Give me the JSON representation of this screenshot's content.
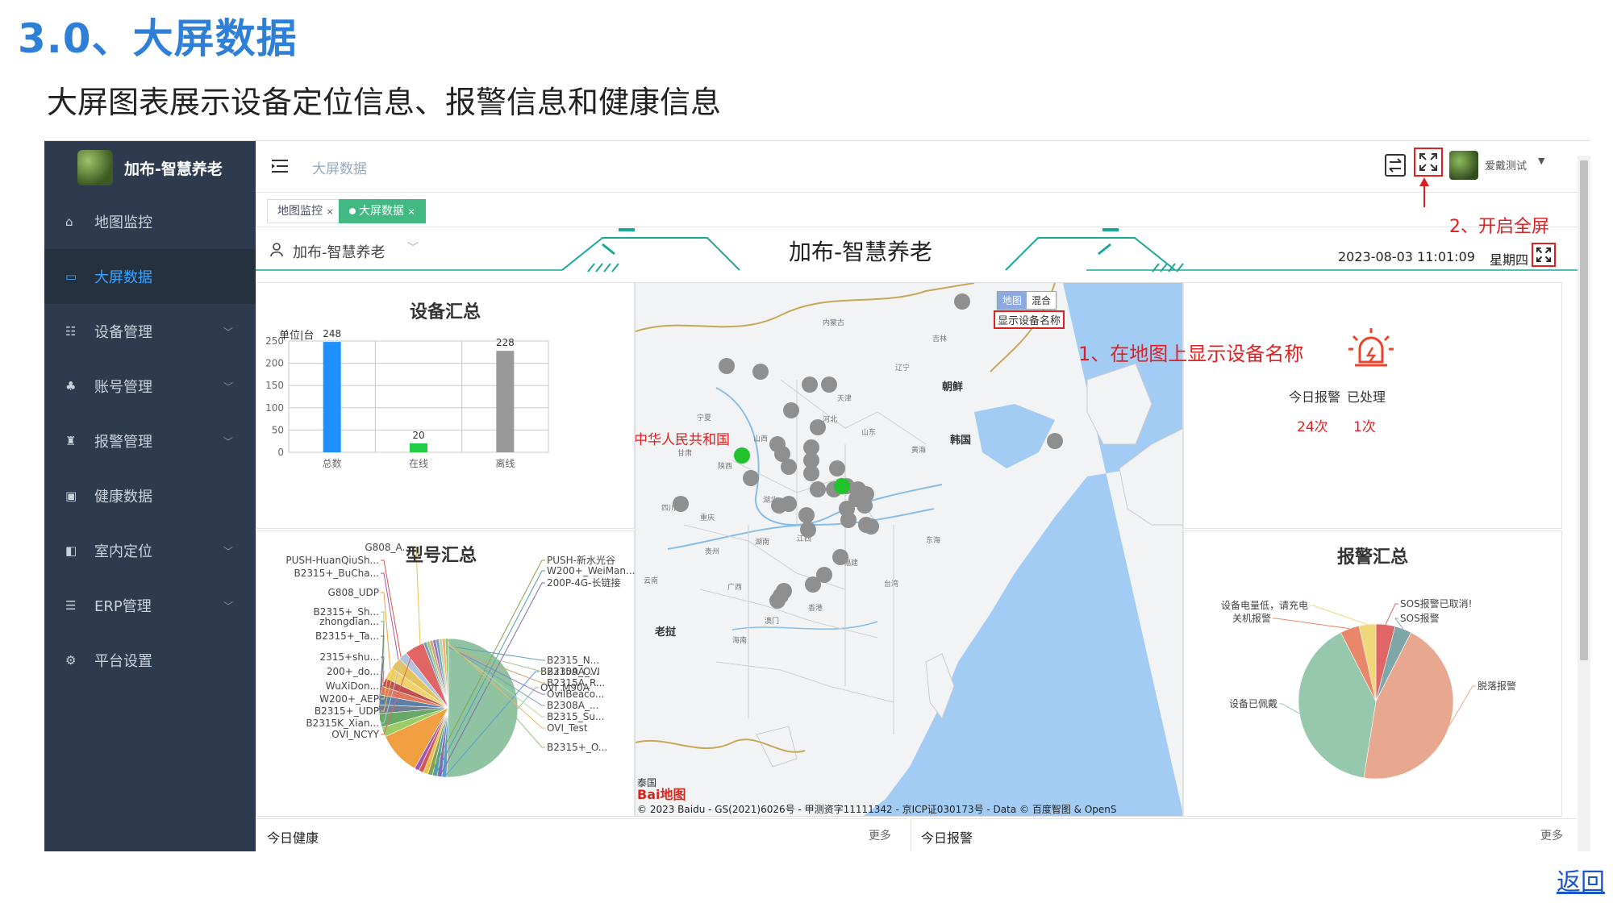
{
  "doc": {
    "heading": "3.0、大屏数据",
    "subheading": "大屏图表展示设备定位信息、报警信息和健康信息",
    "back_link": "返回"
  },
  "sidebar": {
    "brand": "加布-智慧养老",
    "items": [
      {
        "label": "地图监控",
        "icon": "home-icon",
        "active": false,
        "expandable": false
      },
      {
        "label": "大屏数据",
        "icon": "chart-icon",
        "active": true,
        "expandable": false
      },
      {
        "label": "设备管理",
        "icon": "device-icon",
        "active": false,
        "expandable": true
      },
      {
        "label": "账号管理",
        "icon": "org-icon",
        "active": false,
        "expandable": true
      },
      {
        "label": "报警管理",
        "icon": "alarm-icon",
        "active": false,
        "expandable": true
      },
      {
        "label": "健康数据",
        "icon": "health-icon",
        "active": false,
        "expandable": false
      },
      {
        "label": "室内定位",
        "icon": "location-icon",
        "active": false,
        "expandable": true
      },
      {
        "label": "ERP管理",
        "icon": "list-icon",
        "active": false,
        "expandable": true
      },
      {
        "label": "平台设置",
        "icon": "gear-icon",
        "active": false,
        "expandable": false
      }
    ]
  },
  "header": {
    "breadcrumb": "大屏数据",
    "username": "爱戴测试",
    "tabs": [
      "地图监控",
      "大屏数据"
    ]
  },
  "dashboard": {
    "org_select": "加布-智慧养老",
    "title": "加布-智慧养老",
    "datetime": "2023-08-03 11:01:09",
    "weekday": "星期四"
  },
  "annotations": {
    "fullscreen": "2、开启全屏",
    "show_names": "1、在地图上显示设备名称"
  },
  "device_summary": {
    "title": "设备汇总",
    "unit": "单位|台"
  },
  "model_summary": {
    "title": "型号汇总"
  },
  "map": {
    "btn_map": "地图",
    "btn_mixed": "混合",
    "show_names_btn": "显示设备名称",
    "country_label": "中华人民共和国",
    "copyright": "© 2023 Baidu - GS(2021)6026号 - 甲测资字11111342 - 京ICP证030173号 - Data © 百度智图 & OpenS",
    "labels": {
      "neimenggu": "内蒙古",
      "jilin": "吉林",
      "liaoning": "辽宁",
      "chaoxian": "朝鲜",
      "hanguo": "韩国",
      "tianjin": "天津",
      "hebei": "河北",
      "shanxi": "山西",
      "shandong": "山东",
      "ningxia": "宁夏",
      "gansu": "甘肃",
      "shaanxi": "陕西",
      "huanghai": "黄海",
      "sichuan": "四川",
      "hubei": "湖北",
      "chongqing": "重庆",
      "donghai": "东海",
      "guizhou": "贵州",
      "hunan": "湖南",
      "jiangxi": "江西",
      "fujian": "福建",
      "yunnan": "云南",
      "guangxi": "广西",
      "taiwan": "台湾",
      "laowo": "老挝",
      "hainan": "海南",
      "aomen": "澳门",
      "xianggang": "香港",
      "taiguo": "泰国"
    },
    "baidu_logo": "Bai地图"
  },
  "alarm_today": {
    "today_label": "今日报警",
    "handled_label": "已处理",
    "today_count": "24次",
    "handled_count": "1次"
  },
  "alarm_summary": {
    "title": "报警汇总"
  },
  "bottom": {
    "health_title": "今日健康",
    "alarm_title": "今日报警",
    "more": "更多"
  },
  "colors": {
    "sidebar_bg": "#2e3b4e",
    "active_blue": "#3aa3ff",
    "tab_green": "#42b983",
    "annotation_red": "#e02020",
    "teal": "#1aa79a"
  },
  "chart_data": [
    {
      "type": "bar",
      "title": "设备汇总",
      "ylabel": "单位|台",
      "categories": [
        "总数",
        "在线",
        "离线"
      ],
      "values": [
        248,
        20,
        228
      ],
      "colors": [
        "#1e90ff",
        "#22cc44",
        "#999999"
      ],
      "ylim": [
        0,
        250
      ],
      "yticks": [
        0,
        50,
        100,
        150,
        200,
        250
      ],
      "grid": true
    },
    {
      "type": "pie",
      "title": "型号汇总",
      "slices": [
        {
          "label": "OVI_M90A",
          "value": 55,
          "color": "#8fc3a2"
        },
        {
          "label": "B2315A_OVI",
          "value": 1.2,
          "color": "#5a9bd4"
        },
        {
          "label": "200P-4G-长链接",
          "value": 1.2,
          "color": "#7f6bb5"
        },
        {
          "label": "W200+_WeiMan...",
          "value": 1.2,
          "color": "#4aa0a8"
        },
        {
          "label": "PUSH-新水光谷",
          "value": 1.2,
          "color": "#8aa04c"
        },
        {
          "label": "G808_A...",
          "value": 1.2,
          "color": "#e8c04a"
        },
        {
          "label": "PUSH-HuanQiuSh...",
          "value": 1.2,
          "color": "#d9534f"
        },
        {
          "label": "B2315+_BuCha...",
          "value": 1.2,
          "color": "#9b59b6"
        },
        {
          "label": "G808_UDP",
          "value": 11,
          "color": "#f0a040"
        },
        {
          "label": "B2315+_Sh...",
          "value": 2.5,
          "color": "#9ccc65"
        },
        {
          "label": "zhongdian...",
          "value": 3.5,
          "color": "#66aa66"
        },
        {
          "label": "B2315+_Ta...",
          "value": 2.2,
          "color": "#708090"
        },
        {
          "label": "2315+shu...",
          "value": 2.5,
          "color": "#5b7fa6"
        },
        {
          "label": "200+_do...",
          "value": 2.2,
          "color": "#e07860"
        },
        {
          "label": "WuXiDon...",
          "value": 2.2,
          "color": "#c0504d"
        },
        {
          "label": "W200+_AEP",
          "value": 3,
          "color": "#f2d36b"
        },
        {
          "label": "B2315+_UDP",
          "value": 3,
          "color": "#e6c25a"
        },
        {
          "label": "B2315K_Xian...",
          "value": 2.2,
          "color": "#b0c4de"
        },
        {
          "label": "OVI_NCYY",
          "value": 5,
          "color": "#e06666"
        },
        {
          "label": "B2315_N...",
          "value": 0.8,
          "color": "#6a9fb5"
        },
        {
          "label": "B2309A_...",
          "value": 0.8,
          "color": "#a3c586"
        },
        {
          "label": "B2315A_R...",
          "value": 0.8,
          "color": "#d4a373"
        },
        {
          "label": "OvilBeaco...",
          "value": 0.8,
          "color": "#8e7cc3"
        },
        {
          "label": "B2308A_...",
          "value": 0.8,
          "color": "#76a5af"
        },
        {
          "label": "B2315_Su...",
          "value": 0.8,
          "color": "#b6d7a8"
        },
        {
          "label": "OVI_Test",
          "value": 0.8,
          "color": "#f6b26b"
        },
        {
          "label": "B2315+_O...",
          "value": 0.8,
          "color": "#93c47d"
        }
      ]
    },
    {
      "type": "pie",
      "title": "报警汇总",
      "slices": [
        {
          "label": "SOS报警已取消!",
          "value": 4,
          "color": "#e06666"
        },
        {
          "label": "SOS报警",
          "value": 3.5,
          "color": "#7fa7a8"
        },
        {
          "label": "脱落报警",
          "value": 45,
          "color": "#e8a78f"
        },
        {
          "label": "设备已佩戴",
          "value": 40,
          "color": "#96c8ad"
        },
        {
          "label": "关机报警",
          "value": 4,
          "color": "#e8876a"
        },
        {
          "label": "设备电量低，请充电",
          "value": 3.5,
          "color": "#f0d77a"
        }
      ]
    }
  ]
}
